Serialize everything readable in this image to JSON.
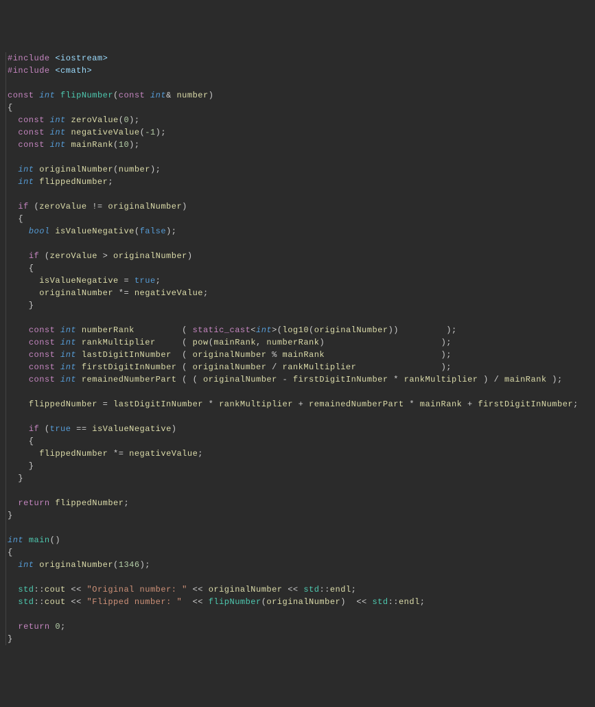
{
  "code": {
    "l1_preproc": "#include",
    "l1_header": "<iostream>",
    "l2_preproc": "#include",
    "l2_header": "<cmath>",
    "l4_const": "const",
    "l4_int": "int",
    "l4_func": "flipNumber",
    "l4_const2": "const",
    "l4_int2": "int",
    "l4_param": "number",
    "l6_const": "const",
    "l6_int": "int",
    "l6_var": "zeroValue",
    "l6_num": "0",
    "l7_const": "const",
    "l7_int": "int",
    "l7_var": "negativeValue",
    "l7_num": "-1",
    "l8_const": "const",
    "l8_int": "int",
    "l8_var": "mainRank",
    "l8_num": "10",
    "l10_int": "int",
    "l10_var": "originalNumber",
    "l10_param": "number",
    "l11_int": "int",
    "l11_var": "flippedNumber",
    "l13_if": "if",
    "l13_var1": "zeroValue",
    "l13_var2": "originalNumber",
    "l15_bool": "bool",
    "l15_var": "isValueNegative",
    "l15_false": "false",
    "l17_if": "if",
    "l17_var1": "zeroValue",
    "l17_var2": "originalNumber",
    "l19_var": "isValueNegative",
    "l19_true": "true",
    "l20_var1": "originalNumber",
    "l20_var2": "negativeValue",
    "l23_const": "const",
    "l23_int": "int",
    "l23_var": "numberRank",
    "l23_cast": "static_cast",
    "l23_casttype": "int",
    "l23_log": "log10",
    "l23_arg": "originalNumber",
    "l24_const": "const",
    "l24_int": "int",
    "l24_var": "rankMultiplier",
    "l24_pow": "pow",
    "l24_arg1": "mainRank",
    "l24_arg2": "numberRank",
    "l25_const": "const",
    "l25_int": "int",
    "l25_var": "lastDigitInNumber",
    "l25_arg1": "originalNumber",
    "l25_arg2": "mainRank",
    "l26_const": "const",
    "l26_int": "int",
    "l26_var": "firstDigitInNumber",
    "l26_arg1": "originalNumber",
    "l26_arg2": "rankMultiplier",
    "l27_const": "const",
    "l27_int": "int",
    "l27_var": "remainedNumberPart",
    "l27_arg1": "originalNumber",
    "l27_arg2": "firstDigitInNumber",
    "l27_arg3": "rankMultiplier",
    "l27_arg4": "mainRank",
    "l29_var": "flippedNumber",
    "l29_v1": "lastDigitInNumber",
    "l29_v2": "rankMultiplier",
    "l29_v3": "remainedNumberPart",
    "l29_v4": "mainRank",
    "l29_v5": "firstDigitInNumber",
    "l31_if": "if",
    "l31_true": "true",
    "l31_var": "isValueNegative",
    "l33_var1": "flippedNumber",
    "l33_var2": "negativeValue",
    "l37_return": "return",
    "l37_var": "flippedNumber",
    "l40_int": "int",
    "l40_main": "main",
    "l42_int": "int",
    "l42_var": "originalNumber",
    "l42_num": "1346",
    "l44_std": "std",
    "l44_cout": "cout",
    "l44_str": "\"Original number: \"",
    "l44_var": "originalNumber",
    "l44_std2": "std",
    "l44_endl": "endl",
    "l45_std": "std",
    "l45_cout": "cout",
    "l45_str": "\"Flipped number: \"",
    "l45_func": "flipNumber",
    "l45_arg": "originalNumber",
    "l45_std2": "std",
    "l45_endl": "endl",
    "l47_return": "return",
    "l47_num": "0"
  }
}
